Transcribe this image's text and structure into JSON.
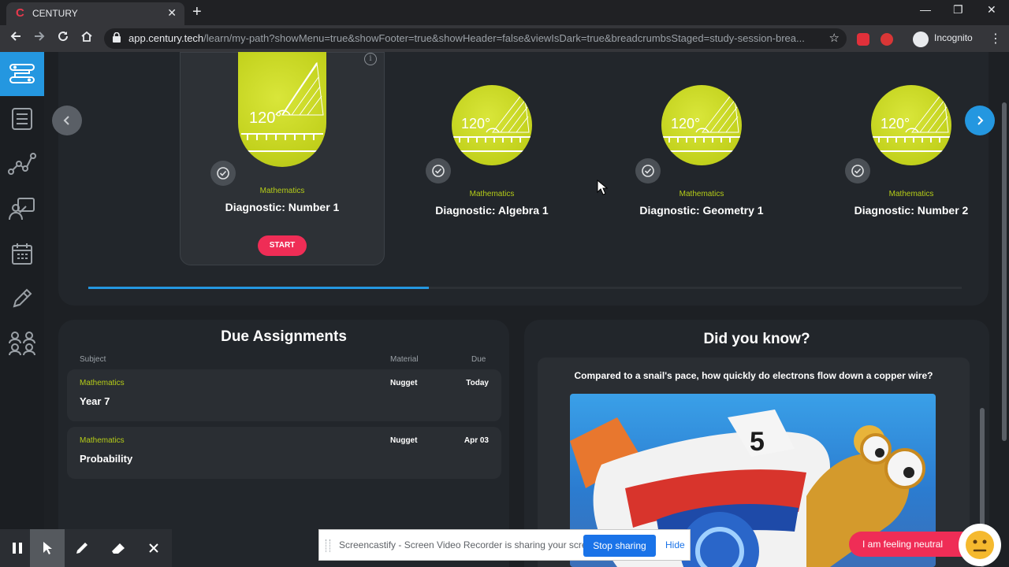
{
  "browser": {
    "tab_title": "CENTURY",
    "tab_logo": "C",
    "tab_close": "✕",
    "new_tab": "+",
    "window_controls": {
      "minimize": "—",
      "restore": "❐",
      "close": "✕"
    },
    "url_host": "app.century.tech",
    "url_path": "/learn/my-path?showMenu=true&showFooter=true&showHeader=false&viewIsDark=true&breadcrumbsStaged=study-session-brea...",
    "incognito_label": "Incognito",
    "extensions": [
      "abp-icon",
      "extension-icon"
    ]
  },
  "sidebar": {
    "items": [
      {
        "icon": "my-path-icon",
        "active": true
      },
      {
        "icon": "courses-list-icon",
        "active": false
      },
      {
        "icon": "graph-icon",
        "active": false
      },
      {
        "icon": "teacher-icon",
        "active": false
      },
      {
        "icon": "calendar-icon",
        "active": false
      },
      {
        "icon": "pencil-icon",
        "active": false
      },
      {
        "icon": "group-icon",
        "active": false
      }
    ],
    "help": "?"
  },
  "carousel": {
    "cards": [
      {
        "subject": "Mathematics",
        "title": "Diagnostic: Number 1",
        "selected": true,
        "medal_label": "120°"
      },
      {
        "subject": "Mathematics",
        "title": "Diagnostic: Algebra 1",
        "selected": false,
        "medal_label": "120°"
      },
      {
        "subject": "Mathematics",
        "title": "Diagnostic: Geometry 1",
        "selected": false,
        "medal_label": "120°"
      },
      {
        "subject": "Mathematics",
        "title": "Diagnostic: Number 2",
        "selected": false,
        "medal_label": "120°"
      }
    ],
    "start_label": "START",
    "progress_fraction": 0.39
  },
  "assignments": {
    "title": "Due Assignments",
    "columns": {
      "subject": "Subject",
      "material": "Material",
      "due": "Due"
    },
    "rows": [
      {
        "subject": "Mathematics",
        "title": "Year 7",
        "material": "Nugget",
        "due": "Today"
      },
      {
        "subject": "Mathematics",
        "title": "Probability",
        "material": "Nugget",
        "due": "Apr 03"
      }
    ]
  },
  "did_you_know": {
    "title": "Did you know?",
    "question": "Compared to a snail's pace, how quickly do electrons flow down a copper wire?"
  },
  "screencastify": {
    "message": "Screencastify - Screen Video Recorder is sharing your screen.",
    "stop_label": "Stop sharing",
    "hide_label": "Hide"
  },
  "feeling": {
    "label": "I am feeling neutral"
  },
  "colors": {
    "accent": "#2497e0",
    "subject_green": "#b5cc18",
    "start_red": "#ef2d56",
    "medal": "#c2d11c"
  }
}
